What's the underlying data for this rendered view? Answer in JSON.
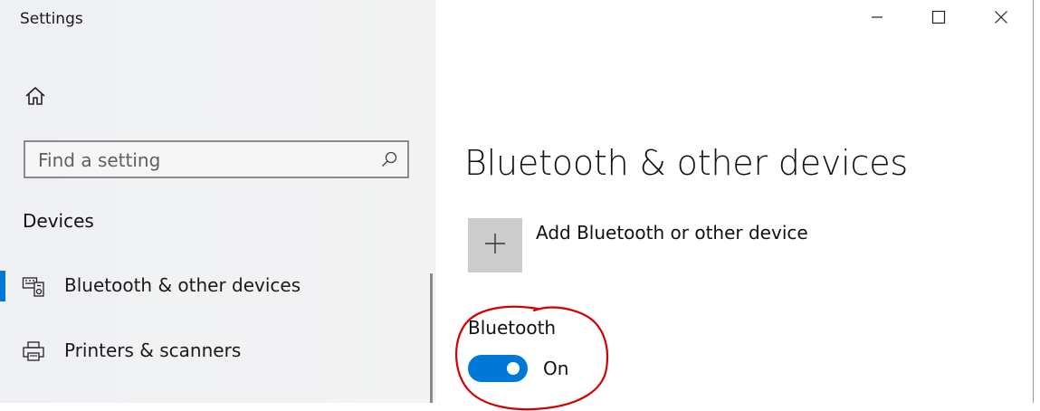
{
  "window": {
    "title": "Settings",
    "controls": {
      "minimize": "minimize-icon",
      "maximize": "maximize-icon",
      "close": "close-icon"
    }
  },
  "sidebar": {
    "home_icon": "home-icon",
    "search": {
      "placeholder": "Find a setting",
      "value": "",
      "icon": "search-icon"
    },
    "section_heading": "Devices",
    "items": [
      {
        "label": "Bluetooth & other devices",
        "icon": "bluetooth-devices-icon",
        "selected": true
      },
      {
        "label": "Printers & scanners",
        "icon": "printer-icon",
        "selected": false
      }
    ]
  },
  "main": {
    "page_title": "Bluetooth & other devices",
    "add_device": {
      "label": "Add Bluetooth or other device",
      "icon": "plus-icon"
    },
    "bluetooth": {
      "label": "Bluetooth",
      "state": "On",
      "enabled": true
    }
  },
  "colors": {
    "accent": "#0078d7",
    "annotation": "#d40000",
    "sidebar_bg": "#f2f2f2",
    "tile_bg": "#cccccc"
  }
}
